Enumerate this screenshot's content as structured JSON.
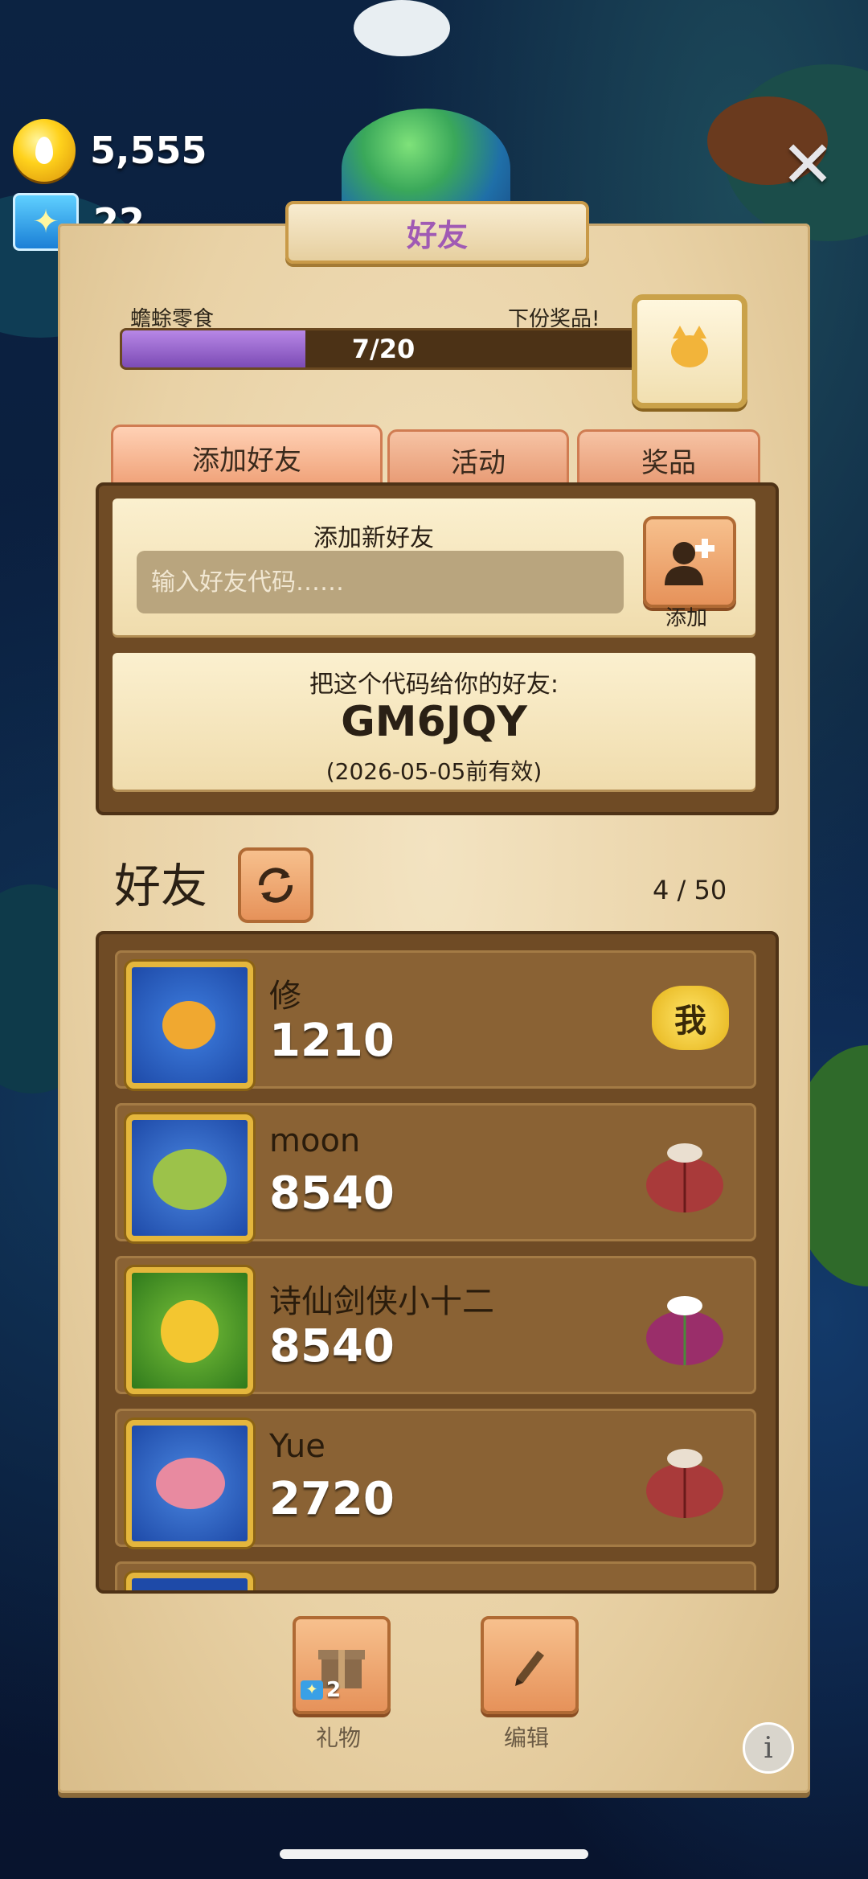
{
  "currency": {
    "coins": "5,555",
    "butterflies": "22"
  },
  "panel": {
    "title": "好友"
  },
  "progress": {
    "label": "蟾蜍零食",
    "next_reward_label": "下份奖品!",
    "value_text": "7/20",
    "fraction": 0.35
  },
  "tabs": {
    "add_friend": "添加好友",
    "events": "活动",
    "prizes": "奖品"
  },
  "add_card": {
    "title": "添加新好友",
    "placeholder": "输入好友代码……",
    "add_label": "添加"
  },
  "share_card": {
    "title": "把这个代码给你的好友:",
    "code": "GM6JQY",
    "expiry": "(2026-05-05前有效)"
  },
  "friends": {
    "heading": "好友",
    "count": "4 / 50",
    "me_badge": "我",
    "list": [
      {
        "name": "修",
        "score": "1210"
      },
      {
        "name": "moon",
        "score": "8540"
      },
      {
        "name": "诗仙剑侠小十二",
        "score": "8540"
      },
      {
        "name": "Yue",
        "score": "2720"
      }
    ]
  },
  "footer": {
    "gift_label": "礼物",
    "gift_count": "2",
    "edit_label": "编辑"
  },
  "colors": {
    "accent_purple": "#a05ab4",
    "progress_fill": "#7c4bb5",
    "button_orange": "#e6925a"
  }
}
